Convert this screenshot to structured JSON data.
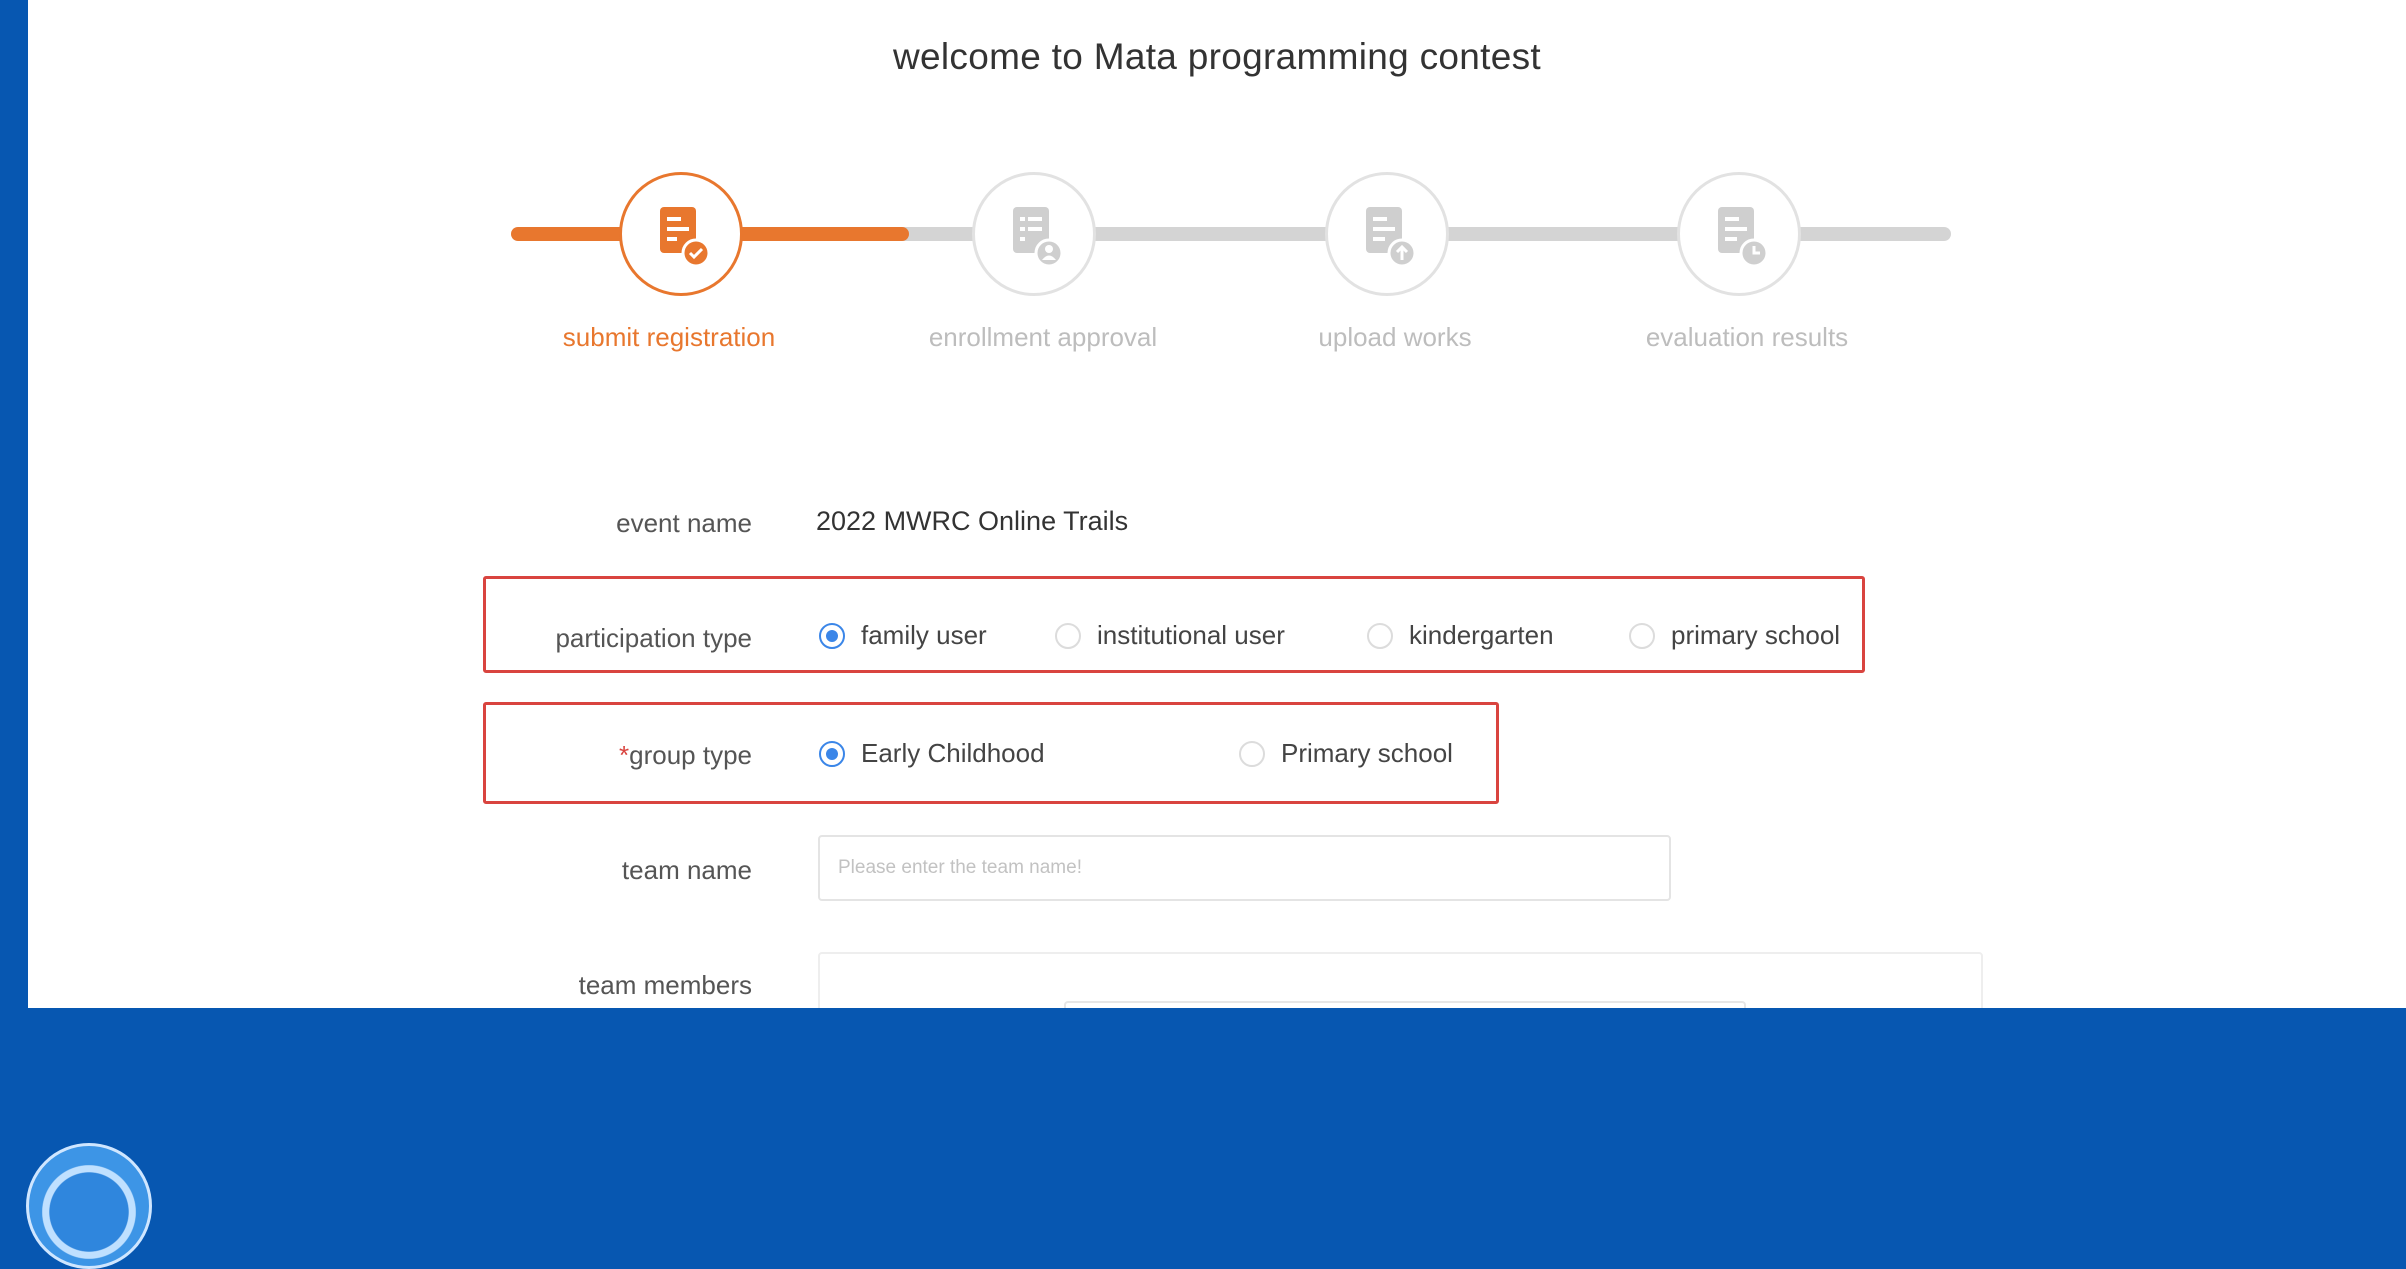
{
  "page": {
    "title": "welcome to Mata programming contest"
  },
  "steps": [
    {
      "label": "submit registration",
      "active": true,
      "icon": "form-check-icon"
    },
    {
      "label": "enrollment approval",
      "active": false,
      "icon": "form-user-icon"
    },
    {
      "label": "upload works",
      "active": false,
      "icon": "form-upload-icon"
    },
    {
      "label": "evaluation results",
      "active": false,
      "icon": "form-clock-icon"
    }
  ],
  "form": {
    "event": {
      "label": "event name",
      "value": "2022 MWRC Online Trails"
    },
    "participation": {
      "label": "participation type",
      "options": [
        "family user",
        "institutional user",
        "kindergarten",
        "primary school"
      ],
      "selected": "family user"
    },
    "group": {
      "required_mark": "*",
      "label": "group type",
      "options": [
        "Early Childhood",
        "Primary school"
      ],
      "selected": "Early Childhood"
    },
    "team_name": {
      "label": "team name",
      "placeholder": "Please enter the team name!",
      "value": ""
    },
    "team_members": {
      "label": "team members"
    }
  },
  "colors": {
    "accent": "#e8772e",
    "radio": "#3b86e8",
    "highlight": "#d9443f",
    "background": "#0757b1"
  }
}
